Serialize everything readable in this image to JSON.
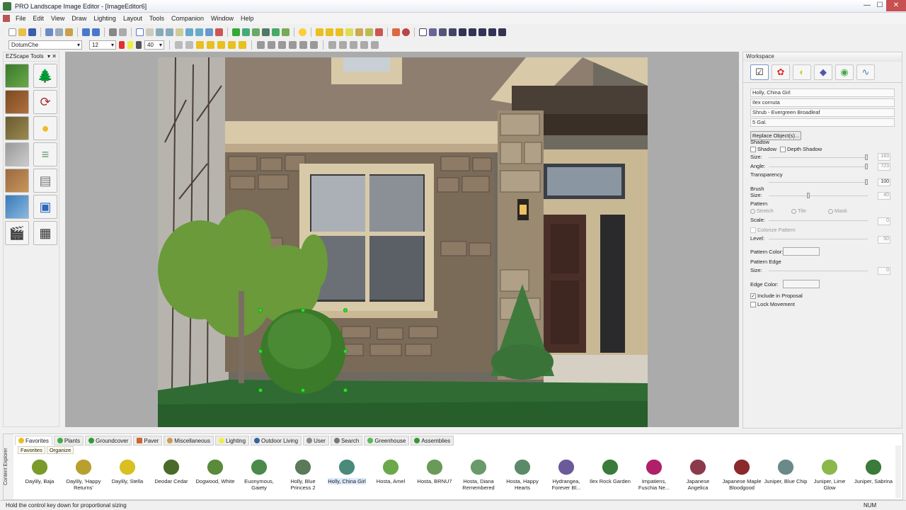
{
  "window": {
    "title": "PRO Landscape Image Editor - [ImageEditor6]",
    "minimize": "—",
    "maximize": "☐",
    "close": "✕"
  },
  "menu": [
    "File",
    "Edit",
    "View",
    "Draw",
    "Lighting",
    "Layout",
    "Tools",
    "Companion",
    "Window",
    "Help"
  ],
  "format": {
    "font": "DotumChe",
    "size": "12",
    "brush": "40"
  },
  "ezscape": {
    "title": "EZScape Tools",
    "pin": "▾ ✕"
  },
  "workspace": {
    "title": "Workspace",
    "name": "Holly, China Girl",
    "botanical": "Ilex cornuta",
    "type": "Shrub - Evergreen Broadleaf",
    "size": "5 Gal.",
    "replace_button": "Replace Object(s)...",
    "shadow_label": "Shadow",
    "shadow_chk": "Shadow",
    "depth_shadow_chk": "Depth Shadow",
    "size_label": "Size:",
    "size_val": "183",
    "angle_label": "Angle:",
    "angle_val": "723",
    "transparency_label": "Transparency",
    "transparency_val": "100",
    "brush_label": "Brush",
    "brush_size_label": "Size:",
    "brush_size_val": "40",
    "pattern_label": "Pattern",
    "stretch": "Stretch",
    "tile": "Tile",
    "mask": "Mask",
    "scale_label": "Scale:",
    "scale_val": "0",
    "colorize": "Colorize Pattern",
    "level_label": "Level:",
    "level_val": "50",
    "pattern_color": "Pattern Color:",
    "pattern_edge": "Pattern Edge",
    "pe_size_label": "Size:",
    "pe_size_val": "0",
    "edge_color": "Edge Color:",
    "include_proposal": "Include in Proposal",
    "lock_movement": "Lock Movement"
  },
  "explorer": {
    "side_label": "Content Explorer",
    "tabs": [
      "Favorites",
      "Plants",
      "Groundcover",
      "Paver",
      "Miscellaneous",
      "Lighting",
      "Outdoor Living",
      "User",
      "Search",
      "Greenhouse",
      "Assemblies"
    ],
    "subtabs": [
      "Favorites",
      "Organize"
    ],
    "plants": [
      "Daylily, Baja",
      "Daylily, 'Happy Returns'",
      "Daylily, Stella",
      "Deodar Cedar",
      "Dogwood, White",
      "Euonymous, Gaiety",
      "Holly, Blue Princess 2",
      "Holly, China Girl",
      "Hosta, Amel",
      "Hosta, BRNU7",
      "Hosta, Diana Remembered",
      "Hosta, Happy Hearts",
      "Hydrangea, Forever Bl...",
      "Ilex Rock Garden",
      "Impatiens, Fuschia Ne...",
      "Japanese Angelica",
      "Japanese Maple Bloodgood",
      "Juniper, Blue Chip",
      "Juniper, Lime Glow",
      "Juniper, Sabrina"
    ]
  },
  "status": {
    "message": "Hold the control key down for proportional sizing",
    "num": "NUM"
  },
  "colors": {
    "grass": "#2f6b33",
    "stone": "#7a6a58",
    "door": "#4a2f28",
    "stucco": "#8e7e70"
  }
}
